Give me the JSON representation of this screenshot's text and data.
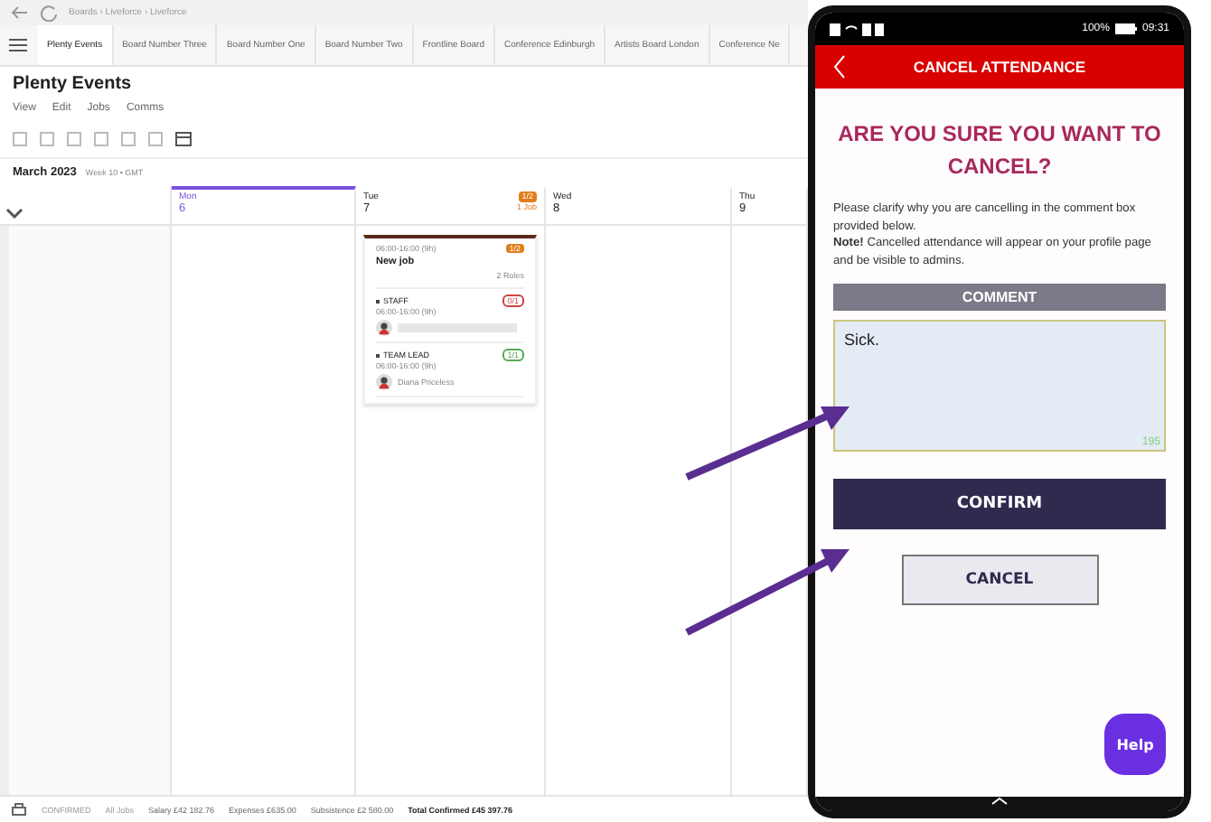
{
  "browser": {
    "breadcrumb": "Boards › Liveforce › Liveforce"
  },
  "tabs": [
    {
      "label": "Plenty Events",
      "selected": true
    },
    {
      "label": "Board Number Three",
      "selected": false
    },
    {
      "label": "Board Number One",
      "selected": false
    },
    {
      "label": "Board Number Two",
      "selected": false
    },
    {
      "label": "Frontline Board",
      "selected": false
    },
    {
      "label": "Conference Edinburgh",
      "selected": false
    },
    {
      "label": "Artists Board London",
      "selected": false
    },
    {
      "label": "Conference Ne",
      "selected": false
    }
  ],
  "board": {
    "title": "Plenty Events",
    "menu": [
      "View",
      "Edit",
      "Jobs",
      "Comms"
    ],
    "month": "March 2023",
    "week": "Week 10 • GMT"
  },
  "days": [
    {
      "name": "Mon",
      "date": "6",
      "selected": true
    },
    {
      "name": "Tue",
      "date": "7",
      "selected": false,
      "badge": "1/2",
      "jobs": "1 Job"
    },
    {
      "name": "Wed",
      "date": "8",
      "selected": false
    },
    {
      "name": "Thu",
      "date": "9",
      "selected": false
    }
  ],
  "job": {
    "time": "06:00-16:00 (9h)",
    "fill": "1/2",
    "title": "New job",
    "roles_count": "2 Roles",
    "roles": [
      {
        "name": "STAFF",
        "fill": "0/1",
        "full": false,
        "time": "06:00-16:00 (9h)"
      },
      {
        "name": "TEAM LEAD",
        "fill": "1/1",
        "full": true,
        "time": "06:00-16:00 (9h)",
        "person": "Diana Priceless"
      }
    ]
  },
  "status_bar": {
    "filter": "CONFIRMED",
    "scope": "All Jobs",
    "salary": "Salary £42 182.76",
    "expenses": "Expenses £635.00",
    "subsistence": "Subsistence £2 580.00",
    "total": "Total Confirmed £45 397.76"
  },
  "phone": {
    "battery": "100%",
    "time": "09:31",
    "header": "CANCEL ATTENDANCE",
    "question": "ARE YOU SURE YOU WANT TO CANCEL?",
    "info": "Please clarify why you are cancelling in the comment box provided below.",
    "note": "**Note!** Cancelled attendance will appear on your profile page and be visible to admins.",
    "comment_label": "COMMENT",
    "comment": "Sick.",
    "counter": "195",
    "confirm": "CONFIRM",
    "cancel": "CANCEL",
    "help": "Help"
  }
}
